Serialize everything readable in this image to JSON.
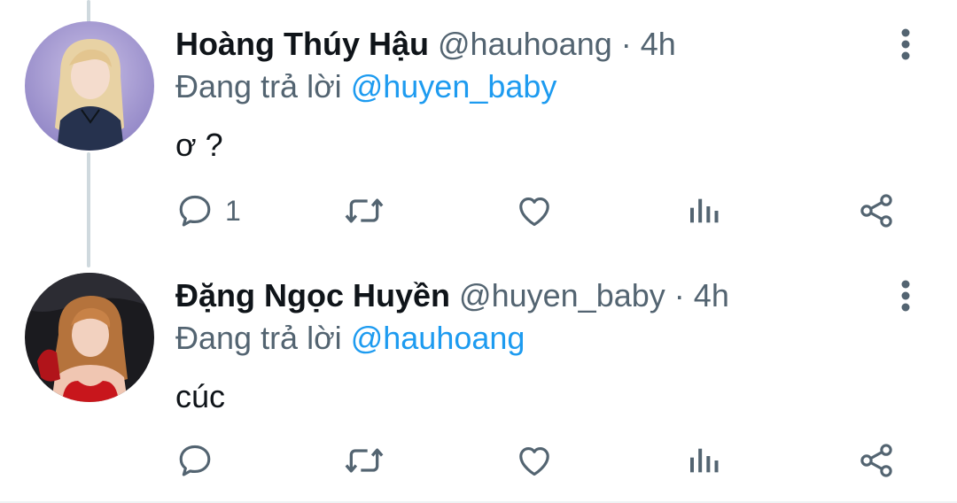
{
  "tweets": [
    {
      "author_name": "Hoàng Thúy Hậu",
      "handle": "@hauhoang",
      "separator": "·",
      "time": "4h",
      "reply_prefix": "Đang trả lời",
      "reply_mention": "@huyen_baby",
      "text": "ơ ?",
      "reply_count": "1",
      "avatar_icon": "avatar-hoang-thuy-hau"
    },
    {
      "author_name": "Đặng Ngọc Huyền",
      "handle": "@huyen_baby",
      "separator": "·",
      "time": "4h",
      "reply_prefix": "Đang trả lời",
      "reply_mention": "@hauhoang",
      "text": "cúc",
      "reply_count": "",
      "avatar_icon": "avatar-dang-ngoc-huyen"
    }
  ],
  "colors": {
    "text": "#0f1419",
    "secondary": "#536471",
    "mention": "#1d9bf0",
    "thread_line": "#cfd9de"
  },
  "icons": [
    "comment-icon",
    "retweet-icon",
    "like-icon",
    "views-icon",
    "share-icon",
    "more-vertical-icon"
  ]
}
